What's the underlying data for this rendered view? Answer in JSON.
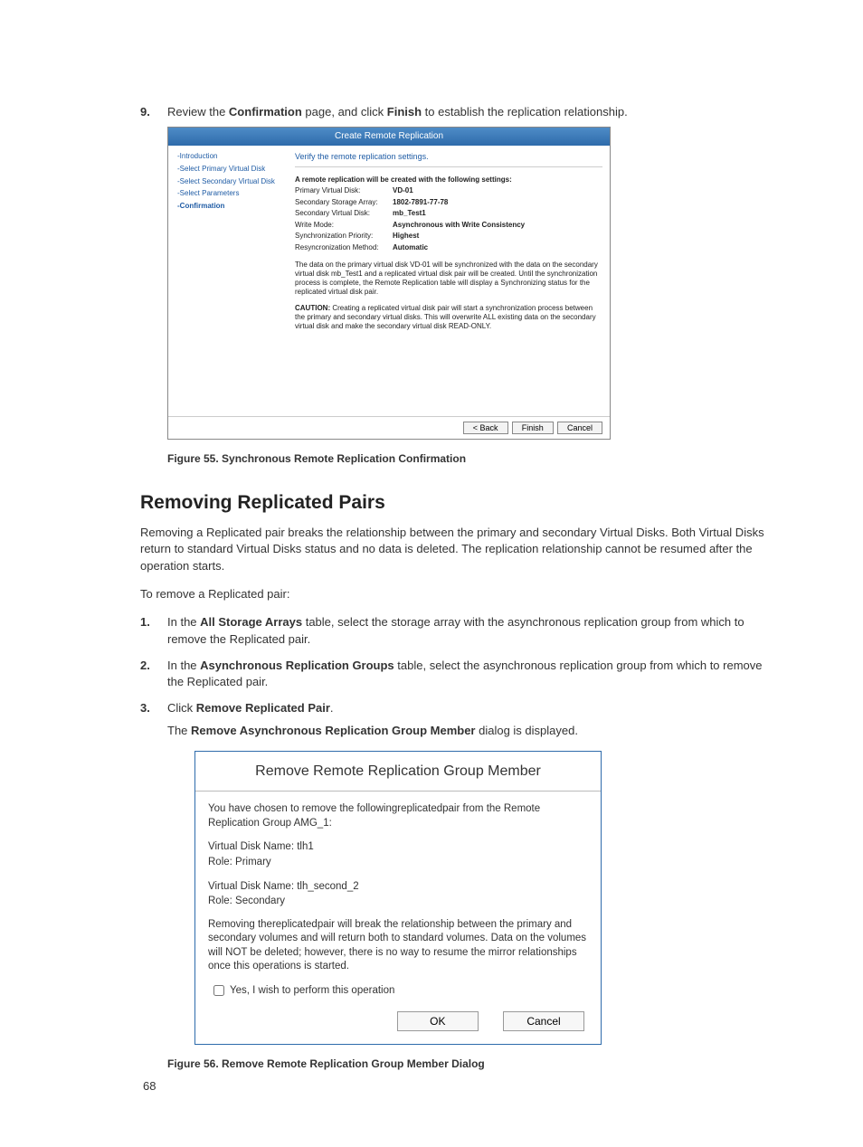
{
  "step9": {
    "num": "9.",
    "text_pre": "Review the ",
    "bold1": "Confirmation",
    "text_mid": " page, and click ",
    "bold2": "Finish",
    "text_post": " to establish the replication relationship."
  },
  "wizard": {
    "title": "Create Remote Replication",
    "side": {
      "intro": "-Introduction",
      "sel_primary": "-Select Primary Virtual Disk",
      "sel_secondary": "-Select Secondary Virtual Disk",
      "sel_params": "-Select Parameters",
      "confirmation": "-Confirmation"
    },
    "verify": "Verify the remote replication settings.",
    "heading": "A remote replication will be created with the following settings:",
    "rows": {
      "pvd_lbl": "Primary Virtual Disk:",
      "pvd_val": "VD-01",
      "ssa_lbl": "Secondary Storage Array:",
      "ssa_val": "1802-7891-77-78",
      "svd_lbl": "Secondary Virtual Disk:",
      "svd_val": "mb_Test1",
      "wm_lbl": "Write Mode:",
      "wm_val": "Asynchronous with Write Consistency",
      "sp_lbl": "Synchronization Priority:",
      "sp_val": "Highest",
      "rm_lbl": "Resyncronization Method:",
      "rm_val": "Automatic"
    },
    "desc": "The data on the primary virtual disk VD-01 will be synchronized with the data on the secondary virtual disk mb_Test1 and a replicated virtual disk pair will be created. Until the synchronization process is complete, the Remote Replication table will display a Synchronizing status for the replicated virtual disk pair.",
    "caution_lbl": "CAUTION:",
    "caution": " Creating a replicated virtual disk pair will start a synchronization process between the primary and secondary virtual disks. This will overwrite ALL existing data on the secondary virtual disk and make the secondary virtual disk READ-ONLY.",
    "back_btn": "< Back",
    "finish_btn": "Finish",
    "cancel_btn": "Cancel"
  },
  "fig55": "Figure 55. Synchronous Remote Replication Confirmation",
  "section_h": "Removing Replicated Pairs",
  "intro_p": "Removing a Replicated pair breaks the relationship between the primary and secondary Virtual Disks. Both Virtual Disks return to standard Virtual Disks status and no data is deleted. The replication relationship cannot be resumed after the operation starts.",
  "lead_p": "To remove a Replicated pair:",
  "step1": {
    "num": "1.",
    "pre": "In the ",
    "b": "All Storage Arrays",
    "post": " table, select the storage array with the asynchronous replication group from which to remove the Replicated pair."
  },
  "step2": {
    "num": "2.",
    "pre": "In the ",
    "b": "Asynchronous Replication Groups",
    "post": " table, select the asynchronous replication group from which to remove the Replicated pair."
  },
  "step3": {
    "num": "3.",
    "line1_pre": "Click ",
    "line1_b": "Remove Replicated Pair",
    "line1_post": ".",
    "line2_pre": "The ",
    "line2_b": "Remove Asynchronous Replication Group Member",
    "line2_post": " dialog is displayed."
  },
  "dialog": {
    "title": "Remove Remote Replication Group Member",
    "p1": "You have chosen to remove the followingreplicatedpair from the  Remote Replication   Group AMG_1:",
    "p2a": "Virtual Disk Name: tlh1",
    "p2b": "Role: Primary",
    "p3a": "Virtual Disk Name: tlh_second_2",
    "p3b": "Role: Secondary",
    "p4": "Removing thereplicatedpair will break the relationship between the primary and secondary volumes and will return both to standard volumes. Data on the volumes will NOT be deleted; however, there is no way to resume the mirror relationships once this operations is started.",
    "check": "Yes, I wish to perform this operation",
    "ok": "OK",
    "cancel": "Cancel"
  },
  "fig56": "Figure 56. Remove Remote Replication Group Member Dialog",
  "page_num": "68"
}
